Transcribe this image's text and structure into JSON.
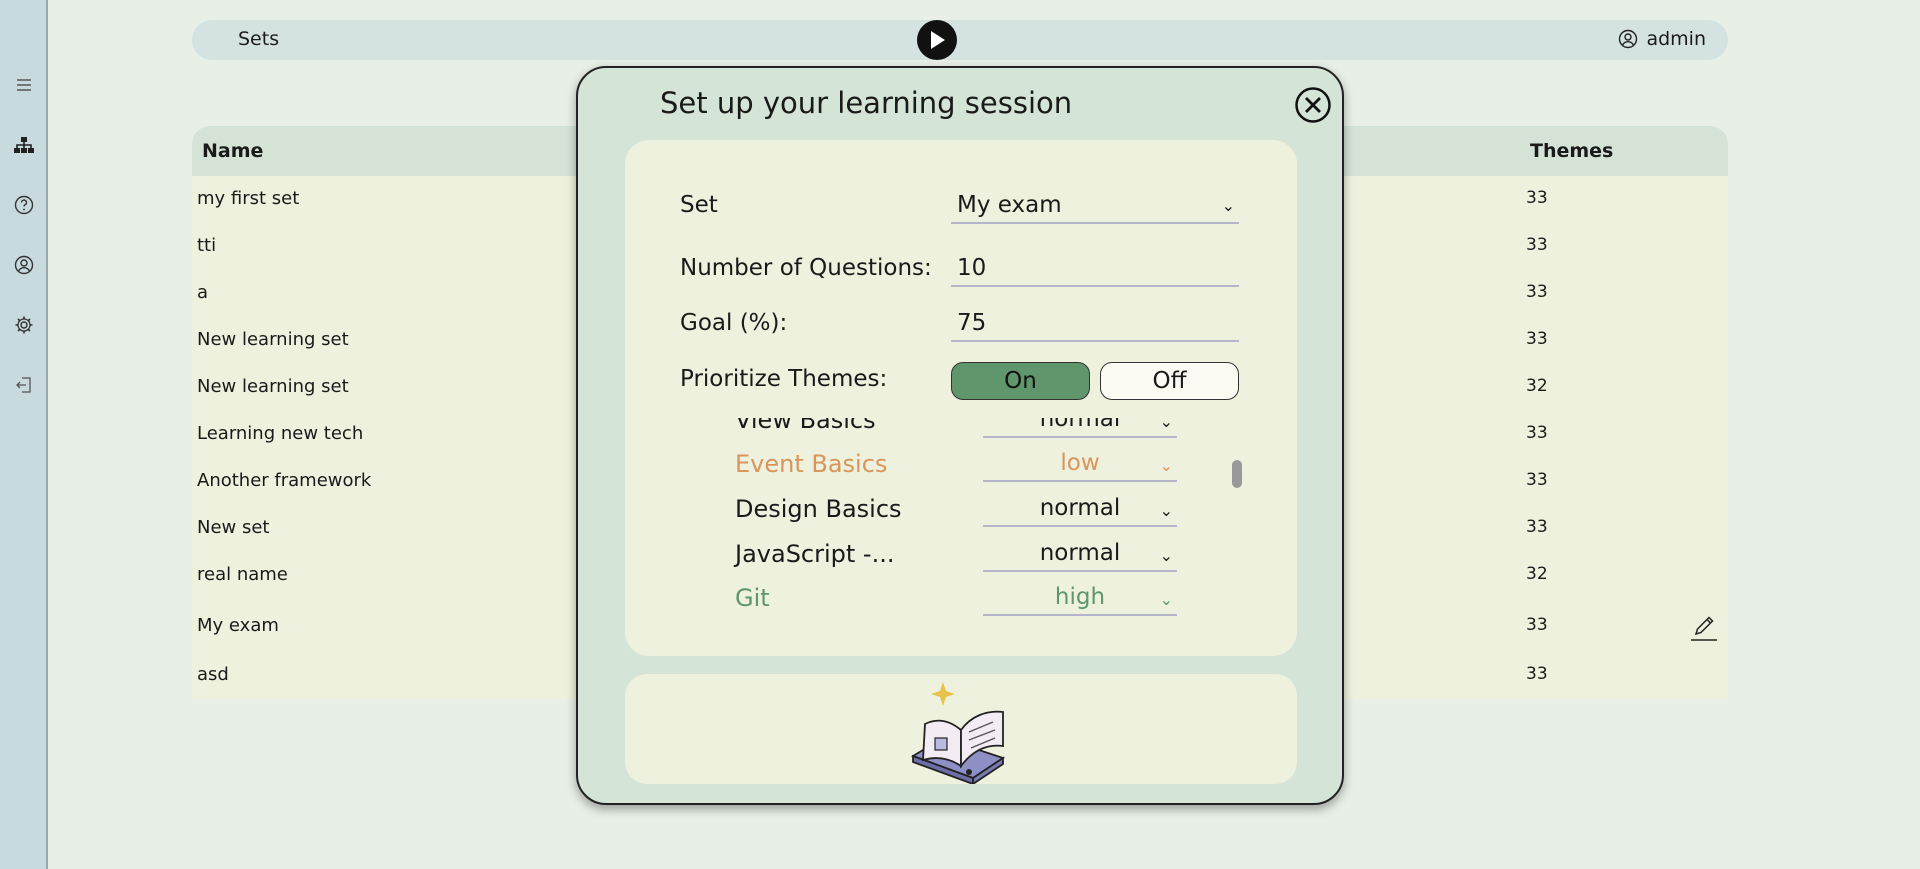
{
  "topbar": {
    "title": "Sets",
    "user": "admin"
  },
  "table": {
    "headers": {
      "name": "Name",
      "themes": "Themes"
    },
    "rows": [
      {
        "name": "my first set",
        "themes": "33"
      },
      {
        "name": "tti",
        "themes": "33"
      },
      {
        "name": "a",
        "themes": "33"
      },
      {
        "name": "New learning set",
        "themes": "33"
      },
      {
        "name": "New learning set",
        "themes": "32"
      },
      {
        "name": "Learning new tech",
        "themes": "33"
      },
      {
        "name": "Another framework",
        "themes": "33"
      },
      {
        "name": "New set",
        "themes": "33"
      },
      {
        "name": "real name",
        "themes": "32"
      },
      {
        "name": "My exam",
        "themes": "33"
      },
      {
        "name": "asd",
        "themes": "33"
      }
    ]
  },
  "modal": {
    "title": "Set up your learning session",
    "set_label": "Set",
    "set_value": "My exam",
    "questions_label": "Number of Questions:",
    "questions_value": "10",
    "goal_label": "Goal (%):",
    "goal_value": "75",
    "prioritize_label": "Prioritize Themes:",
    "on_label": "On",
    "off_label": "Off",
    "themes": [
      {
        "name": "View Basics",
        "priority": "normal",
        "color": "#1a1a1a"
      },
      {
        "name": "Event Basics",
        "priority": "low",
        "color": "#d9955a"
      },
      {
        "name": "Design Basics",
        "priority": "normal",
        "color": "#1a1a1a"
      },
      {
        "name": "JavaScript -...",
        "priority": "normal",
        "color": "#1a1a1a"
      },
      {
        "name": "Git",
        "priority": "high",
        "color": "#5f966c"
      }
    ]
  },
  "colors": {
    "toggle_on": "#5f966c",
    "low": "#d9955a",
    "high": "#5f966c"
  }
}
